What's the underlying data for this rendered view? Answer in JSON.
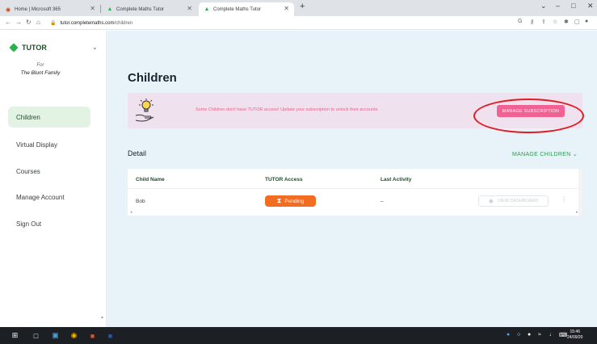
{
  "browser": {
    "tabs": [
      {
        "title": "Home | Microsoft 365",
        "active": false
      },
      {
        "title": "Complete Maths Tutor",
        "active": false
      },
      {
        "title": "Complete Maths Tutor",
        "active": true
      }
    ],
    "new_tab_symbol": "+",
    "url_host_prefix": "tutor.",
    "url_host_rest": "completemaths.com",
    "url_path": "/children",
    "window_controls": {
      "collapse": "⌄",
      "minimize": "–",
      "maximize": "□",
      "close": "✕"
    }
  },
  "sidebar": {
    "logo_text": "TUTOR",
    "for_label": "For",
    "family_name": "The Blunt Family",
    "items": [
      {
        "label": "Children",
        "active": true
      },
      {
        "label": "Virtual Display",
        "active": false
      },
      {
        "label": "Courses",
        "active": false
      },
      {
        "label": "Manage Account",
        "active": false
      },
      {
        "label": "Sign Out",
        "active": false
      }
    ]
  },
  "main": {
    "title": "Children",
    "banner": {
      "message": "Some Children don't have TUTOR access! Update your subscription to unlock their accounts.",
      "button_label": "MANAGE SUBSCRIPTION"
    },
    "detail_label": "Detail",
    "manage_children_label": "MANAGE CHILDREN",
    "table": {
      "headers": [
        "Child Name",
        "TUTOR Access",
        "Last Activity"
      ],
      "rows": [
        {
          "name": "Bob",
          "access": "Pending",
          "last_activity": "–",
          "action": "VIEW DASHBOARD"
        }
      ]
    }
  },
  "taskbar": {
    "time": "15:46",
    "date": "24/09/20"
  },
  "colors": {
    "accent_green": "#2e9a55",
    "banner_bg": "#efe1ee",
    "subscription_button": "#f06292",
    "pending_badge": "#f26d21",
    "annotation_circle": "#e01b24"
  }
}
